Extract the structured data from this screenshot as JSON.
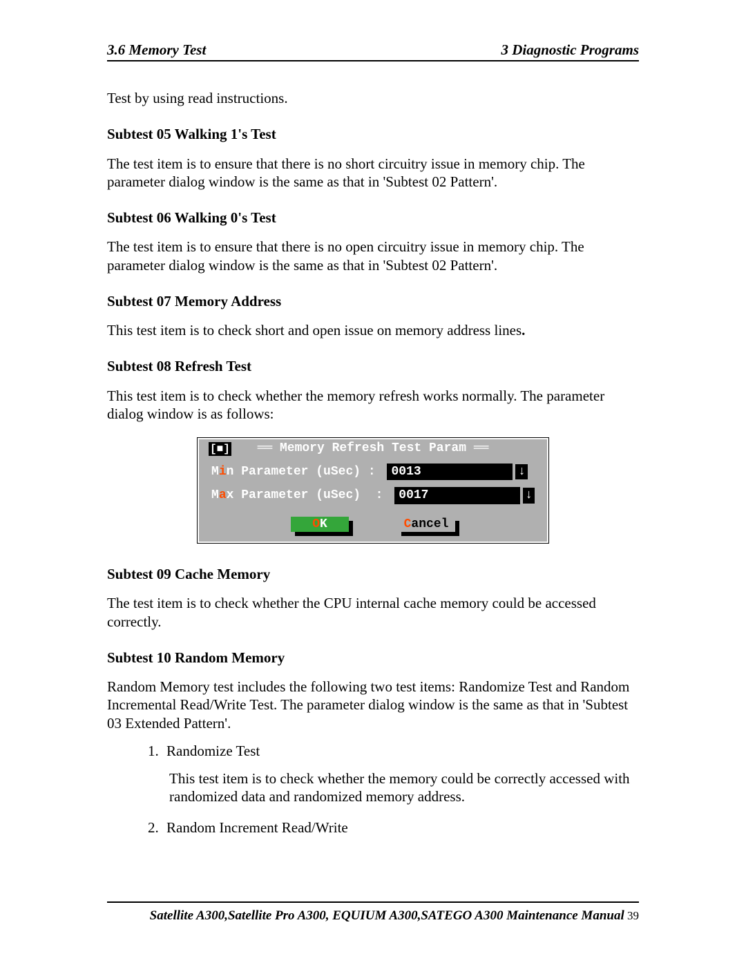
{
  "header": {
    "left": "3.6 Memory Test",
    "right": "3  Diagnostic Programs"
  },
  "intro_line": "Test by using read instructions.",
  "subtests": {
    "s05": {
      "heading": "Subtest 05  Walking 1's Test",
      "body": "The test item is to ensure that there is no short circuitry issue in memory chip. The parameter dialog window is the same as that in 'Subtest 02 Pattern'."
    },
    "s06": {
      "heading": "Subtest 06  Walking 0's Test",
      "body": "The test item is to ensure that there is no open circuitry issue in memory chip. The parameter dialog window is the same as that in 'Subtest 02 Pattern'."
    },
    "s07": {
      "heading": "Subtest 07  Memory Address",
      "body_prefix": "This test item is to check short and open issue on memory address lines",
      "body_suffix": "."
    },
    "s08": {
      "heading": "Subtest 08  Refresh Test",
      "body": "This test item is to check whether the memory refresh works normally. The parameter dialog window is as follows:"
    },
    "s09": {
      "heading": "Subtest 09  Cache Memory",
      "body": "The test item is to check whether the CPU internal cache memory could be accessed correctly."
    },
    "s10": {
      "heading": "Subtest 10  Random Memory",
      "body": "Random Memory test includes the following two test items: Randomize Test and Random Incremental Read/Write Test. The parameter dialog window is the same as that in 'Subtest 03 Extended Pattern'.",
      "item1_title": "Randomize Test",
      "item1_body": "This test item is to check whether the memory could be correctly accessed with randomized data and randomized memory address.",
      "item2_title": "Random Increment Read/Write"
    }
  },
  "dialog": {
    "title": "Memory Refresh Test Param",
    "close_glyph": "[■]",
    "row1_pre": "M",
    "row1_hot": "i",
    "row1_post": "n Parameter (uSec) : ",
    "row1_value": "0013",
    "row2_pre": "M",
    "row2_hot": "a",
    "row2_post": "x Parameter (uSec)  : ",
    "row2_value": "0017",
    "arrow_glyph": "↓",
    "ok_hot": "O",
    "ok_rest": "K",
    "cancel_hot": "C",
    "cancel_rest": "ancel"
  },
  "footer": {
    "text": "Satellite A300,Satellite Pro A300, EQUIUM A300,SATEGO A300 Maintenance Manual",
    "page": " 39"
  }
}
